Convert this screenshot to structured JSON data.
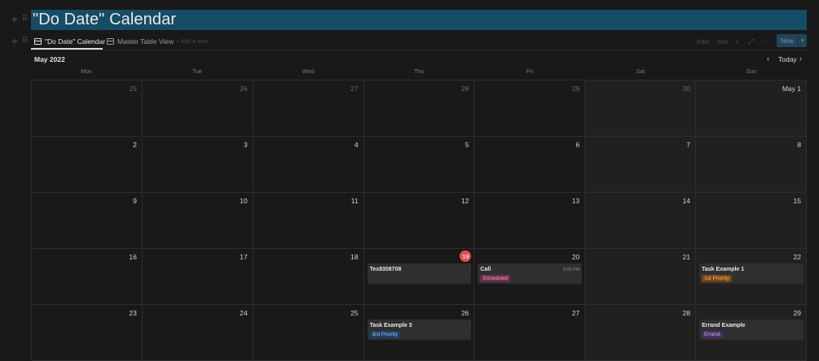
{
  "page": {
    "title": "\"Do Date\" Calendar"
  },
  "tabs": [
    {
      "label": "\"Do Date\" Calendar"
    },
    {
      "label": "Master Table View"
    }
  ],
  "add_view_label": "+ Add a view",
  "toolbar": {
    "filter": "Filter",
    "sort": "Sort",
    "new_label": "New"
  },
  "calendar": {
    "month_label": "May 2022",
    "today_label": "Today",
    "weekdays": [
      "Mon",
      "Tue",
      "Wed",
      "Thu",
      "Fri",
      "Sat",
      "Sun"
    ],
    "weeks": [
      [
        {
          "day": "25",
          "muted": true
        },
        {
          "day": "26",
          "muted": true
        },
        {
          "day": "27",
          "muted": true
        },
        {
          "day": "28",
          "muted": true
        },
        {
          "day": "29",
          "muted": true
        },
        {
          "day": "30",
          "muted": true
        },
        {
          "day": "May 1"
        }
      ],
      [
        {
          "day": "2"
        },
        {
          "day": "3"
        },
        {
          "day": "4"
        },
        {
          "day": "5"
        },
        {
          "day": "6"
        },
        {
          "day": "7"
        },
        {
          "day": "8"
        }
      ],
      [
        {
          "day": "9"
        },
        {
          "day": "10"
        },
        {
          "day": "11"
        },
        {
          "day": "12"
        },
        {
          "day": "13"
        },
        {
          "day": "14"
        },
        {
          "day": "15"
        }
      ],
      [
        {
          "day": "16"
        },
        {
          "day": "17"
        },
        {
          "day": "18"
        },
        {
          "day": "19",
          "today": true,
          "event": {
            "name": "Tes9308708"
          }
        },
        {
          "day": "20",
          "event": {
            "name": "Call",
            "time": "3:00 PM",
            "tag": "Scheduled",
            "tag_bg": "#69304a",
            "tag_fg": "#e9a8c8"
          }
        },
        {
          "day": "21"
        },
        {
          "day": "22",
          "event": {
            "name": "Task Example 1",
            "tag": "1st Priority",
            "tag_bg": "#7a4416",
            "tag_fg": "#f2c08f"
          }
        }
      ],
      [
        {
          "day": "23"
        },
        {
          "day": "24"
        },
        {
          "day": "25"
        },
        {
          "day": "26",
          "event": {
            "name": "Task Example 3",
            "tag": "3rd Priority",
            "tag_bg": "#1e3f66",
            "tag_fg": "#9cc2ef"
          }
        },
        {
          "day": "27"
        },
        {
          "day": "28"
        },
        {
          "day": "29",
          "event": {
            "name": "Errand Example",
            "tag": "Errand",
            "tag_bg": "#472f63",
            "tag_fg": "#c9b0ea"
          }
        }
      ]
    ]
  }
}
